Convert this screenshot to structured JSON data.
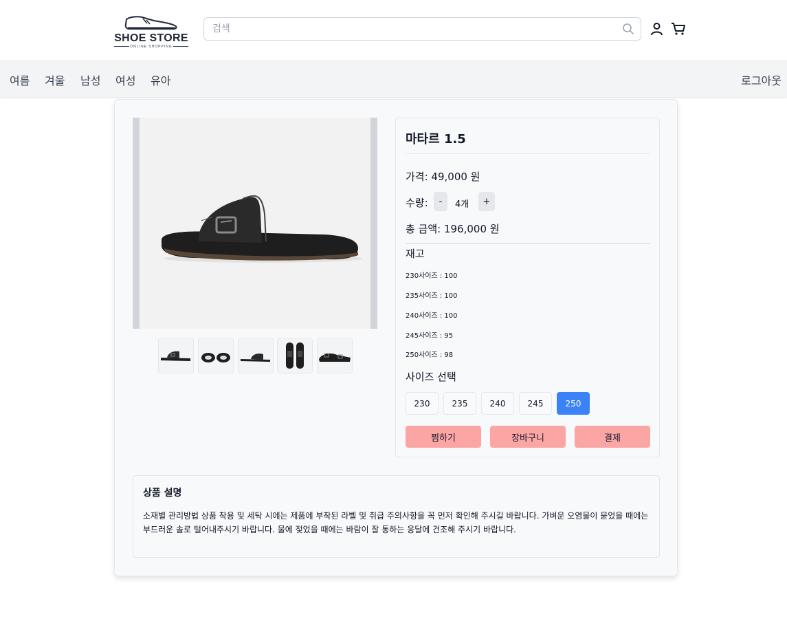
{
  "header": {
    "logo_title": "SHOE STORE",
    "logo_subtitle": "ONLINE SHOPPING",
    "search_placeholder": "검색"
  },
  "nav": {
    "items": [
      "여름",
      "겨울",
      "남성",
      "여성",
      "유아"
    ],
    "logout": "로그아웃"
  },
  "product": {
    "name": "마타르 1.5",
    "price_text": "가격: 49,000 원",
    "quantity_label": "수량:",
    "minus": "-",
    "plus": "+",
    "quantity_value": "4개",
    "total_text": "총 금액: 196,000 원",
    "stock_title": "재고",
    "stock": [
      "230사이즈 : 100",
      "235사이즈 : 100",
      "240사이즈 : 100",
      "245사이즈 : 95",
      "250사이즈 : 98"
    ],
    "size_title": "사이즈 선택",
    "sizes": [
      "230",
      "235",
      "240",
      "245",
      "250"
    ],
    "selected_size": "250",
    "actions": [
      "찜하기",
      "장바구니",
      "결제"
    ]
  },
  "description": {
    "title": "상품 설명",
    "text": "소재별 관리방법 상품 착용 및 세탁 시에는 제품에 부착된 라벨 및 취급 주의사항을 꼭 먼저 확인해 주시길 바랍니다. 가벼운 오염물이 묻었을 때에는 부드러운 솔로 털어내주시기 바랍니다. 물에 젖었을 때에는 바람이 잘 통하는 응달에 건조해 주시기 바랍니다."
  },
  "colors": {
    "accent": "#3b82f6",
    "action": "#fca5a5",
    "nav_bg": "#f3f4f6"
  },
  "icons": [
    "shoe-logo-icon",
    "search-icon",
    "user-icon",
    "cart-icon"
  ]
}
